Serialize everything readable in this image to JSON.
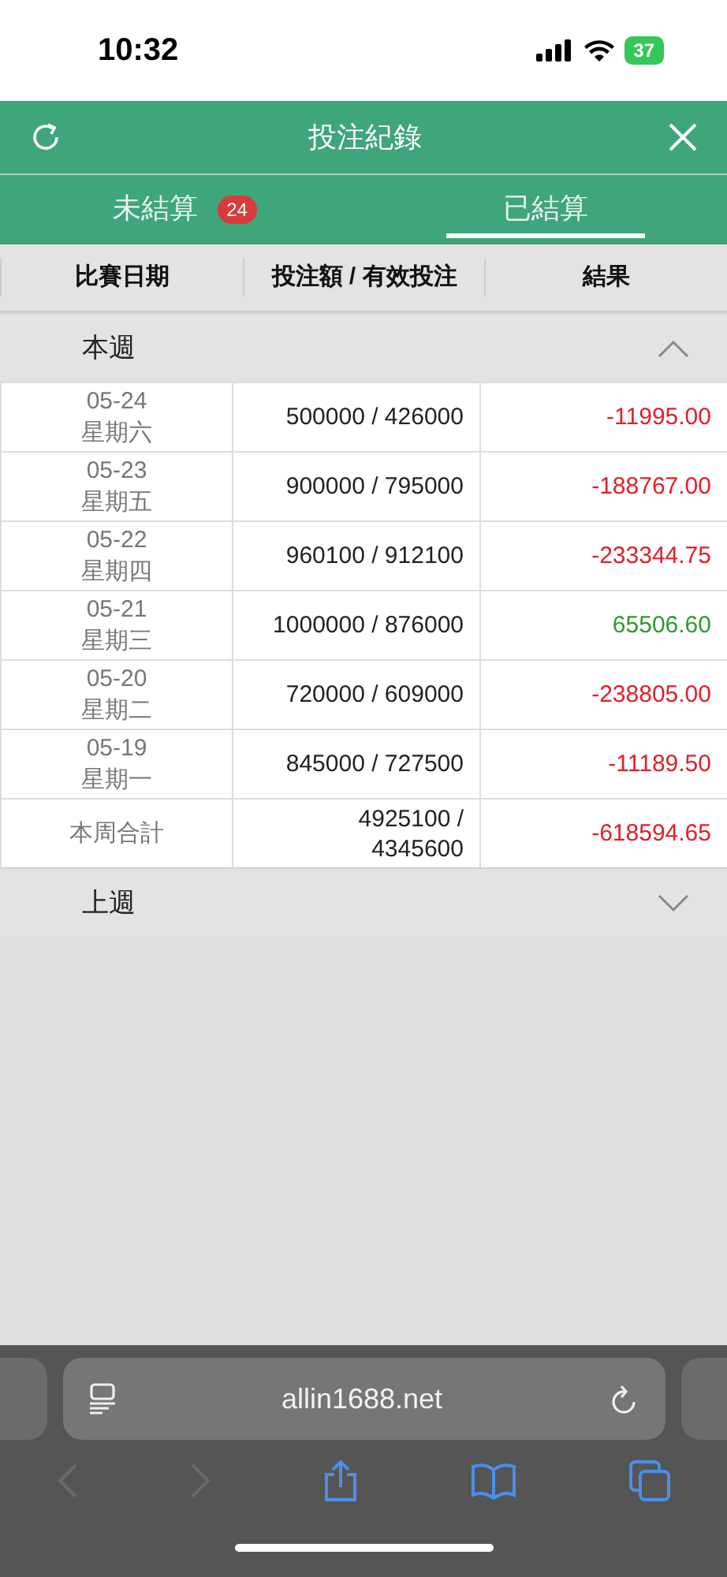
{
  "status_bar": {
    "time": "10:32",
    "battery": "37"
  },
  "header": {
    "title": "投注紀錄"
  },
  "tabs": [
    {
      "label": "未結算",
      "badge": "24",
      "selected": false
    },
    {
      "label": "已結算",
      "selected": true
    }
  ],
  "table": {
    "columns": [
      "比賽日期",
      "投注額 / 有效投注",
      "結果"
    ]
  },
  "sections": [
    {
      "title": "本週",
      "expanded": true,
      "rows": [
        {
          "date": "05-24",
          "weekday": "星期六",
          "amount": "500000 / 426000",
          "result": "-11995.00",
          "color": "#e0202a"
        },
        {
          "date": "05-23",
          "weekday": "星期五",
          "amount": "900000 / 795000",
          "result": "-188767.00",
          "color": "#e0202a"
        },
        {
          "date": "05-22",
          "weekday": "星期四",
          "amount": "960100 / 912100",
          "result": "-233344.75",
          "color": "#e0202a"
        },
        {
          "date": "05-21",
          "weekday": "星期三",
          "amount": "1000000 / 876000",
          "result": "65506.60",
          "color": "#2e9a2e"
        },
        {
          "date": "05-20",
          "weekday": "星期二",
          "amount": "720000 / 609000",
          "result": "-238805.00",
          "color": "#e0202a"
        },
        {
          "date": "05-19",
          "weekday": "星期一",
          "amount": "845000 / 727500",
          "result": "-11189.50",
          "color": "#e0202a"
        }
      ],
      "total": {
        "label": "本周合計",
        "amount": [
          "4925100 /",
          "4345600"
        ],
        "result": "-618594.65",
        "color": "#e0202a"
      }
    },
    {
      "title": "上週",
      "expanded": false
    }
  ],
  "browser": {
    "url": "allin1688.net"
  }
}
